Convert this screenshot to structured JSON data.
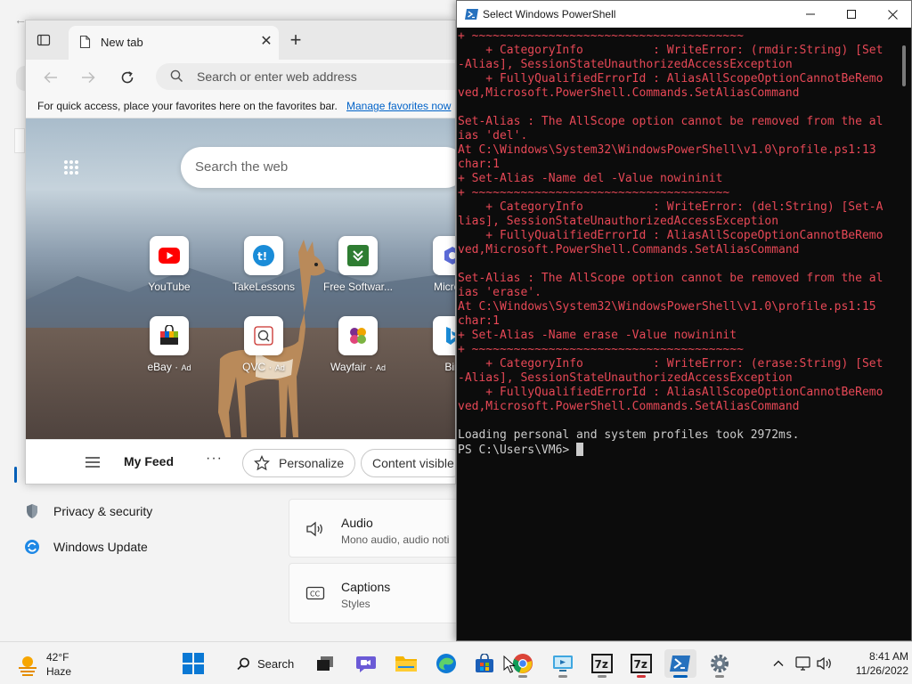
{
  "settings": {
    "nav": [
      {
        "label": "Privacy & security",
        "icon": "shield-icon"
      },
      {
        "label": "Windows Update",
        "icon": "windows-update-icon"
      }
    ],
    "cards": [
      {
        "title": "Audio",
        "subtitle": "Mono audio, audio noti",
        "icon": "speaker-icon"
      },
      {
        "title": "Captions",
        "subtitle": "Styles",
        "icon": "captions-icon"
      }
    ]
  },
  "edge": {
    "tab": {
      "label": "New tab"
    },
    "new_tab_glyph": "+",
    "address": {
      "placeholder": "Search or enter web address"
    },
    "favorites_bar": {
      "text": "For quick access, place your favorites here on the favorites bar.",
      "link": "Manage favorites now"
    },
    "search_web": {
      "placeholder": "Search the web"
    },
    "tiles": [
      {
        "label": "YouTube",
        "ad": ""
      },
      {
        "label": "TakeLessons",
        "ad": ""
      },
      {
        "label": "Free Softwar...",
        "ad": ""
      },
      {
        "label": "Microso",
        "ad": ""
      },
      {
        "label": "eBay",
        "ad": "Ad"
      },
      {
        "label": "QVC",
        "ad": "Ad"
      },
      {
        "label": "Wayfair",
        "ad": "Ad"
      },
      {
        "label": "Bin",
        "ad": ""
      }
    ],
    "feed": {
      "title": "My Feed",
      "more": "···",
      "personalize": "Personalize",
      "content_visible": "Content visible"
    }
  },
  "powershell": {
    "title": "Select Windows PowerShell",
    "lines": [
      {
        "text": "+ ~~~~~~~~~~~~~~~~~~~~~~~~~~~~~~~~~~~~~~~",
        "style": "err"
      },
      {
        "text": "    + CategoryInfo          : WriteError: (rmdir:String) [Set",
        "style": "err"
      },
      {
        "text": "-Alias], SessionStateUnauthorizedAccessException",
        "style": "err"
      },
      {
        "text": "    + FullyQualifiedErrorId : AliasAllScopeOptionCannotBeRemo",
        "style": "err"
      },
      {
        "text": "ved,Microsoft.PowerShell.Commands.SetAliasCommand",
        "style": "err"
      },
      {
        "text": "",
        "style": "err"
      },
      {
        "text": "Set-Alias : The AllScope option cannot be removed from the al",
        "style": "err"
      },
      {
        "text": "ias 'del'.",
        "style": "err"
      },
      {
        "text": "At C:\\Windows\\System32\\WindowsPowerShell\\v1.0\\profile.ps1:13",
        "style": "err"
      },
      {
        "text": "char:1",
        "style": "err"
      },
      {
        "text": "+ Set-Alias -Name del -Value nowininit",
        "style": "err"
      },
      {
        "text": "+ ~~~~~~~~~~~~~~~~~~~~~~~~~~~~~~~~~~~~~",
        "style": "err"
      },
      {
        "text": "    + CategoryInfo          : WriteError: (del:String) [Set-A",
        "style": "err"
      },
      {
        "text": "lias], SessionStateUnauthorizedAccessException",
        "style": "err"
      },
      {
        "text": "    + FullyQualifiedErrorId : AliasAllScopeOptionCannotBeRemo",
        "style": "err"
      },
      {
        "text": "ved,Microsoft.PowerShell.Commands.SetAliasCommand",
        "style": "err"
      },
      {
        "text": "",
        "style": "err"
      },
      {
        "text": "Set-Alias : The AllScope option cannot be removed from the al",
        "style": "err"
      },
      {
        "text": "ias 'erase'.",
        "style": "err"
      },
      {
        "text": "At C:\\Windows\\System32\\WindowsPowerShell\\v1.0\\profile.ps1:15",
        "style": "err"
      },
      {
        "text": "char:1",
        "style": "err"
      },
      {
        "text": "+ Set-Alias -Name erase -Value nowininit",
        "style": "err"
      },
      {
        "text": "+ ~~~~~~~~~~~~~~~~~~~~~~~~~~~~~~~~~~~~~~~",
        "style": "err"
      },
      {
        "text": "    + CategoryInfo          : WriteError: (erase:String) [Set",
        "style": "err"
      },
      {
        "text": "-Alias], SessionStateUnauthorizedAccessException",
        "style": "err"
      },
      {
        "text": "    + FullyQualifiedErrorId : AliasAllScopeOptionCannotBeRemo",
        "style": "err"
      },
      {
        "text": "ved,Microsoft.PowerShell.Commands.SetAliasCommand",
        "style": "err"
      },
      {
        "text": "",
        "style": "out"
      },
      {
        "text": "Loading personal and system profiles took 2972ms.",
        "style": "out"
      }
    ],
    "prompt": "PS C:\\Users\\VM6> "
  },
  "taskbar": {
    "weather": {
      "temp": "42°F",
      "condition": "Haze"
    },
    "search_label": "Search",
    "apps": [
      "start-icon",
      "task-view-icon",
      "chat-icon",
      "file-explorer-icon",
      "edge-icon",
      "store-icon",
      "chrome-icon",
      "remote-desktop-icon",
      "7zip-icon",
      "7zip-icon",
      "powershell-icon",
      "settings-icon"
    ],
    "clock": {
      "time": "8:41 AM",
      "date": "11/26/2022"
    }
  },
  "colors": {
    "accent": "#005fb8",
    "ps_error": "#e74856",
    "ps_text": "#cccccc",
    "ps_background": "#0c0c0c"
  }
}
